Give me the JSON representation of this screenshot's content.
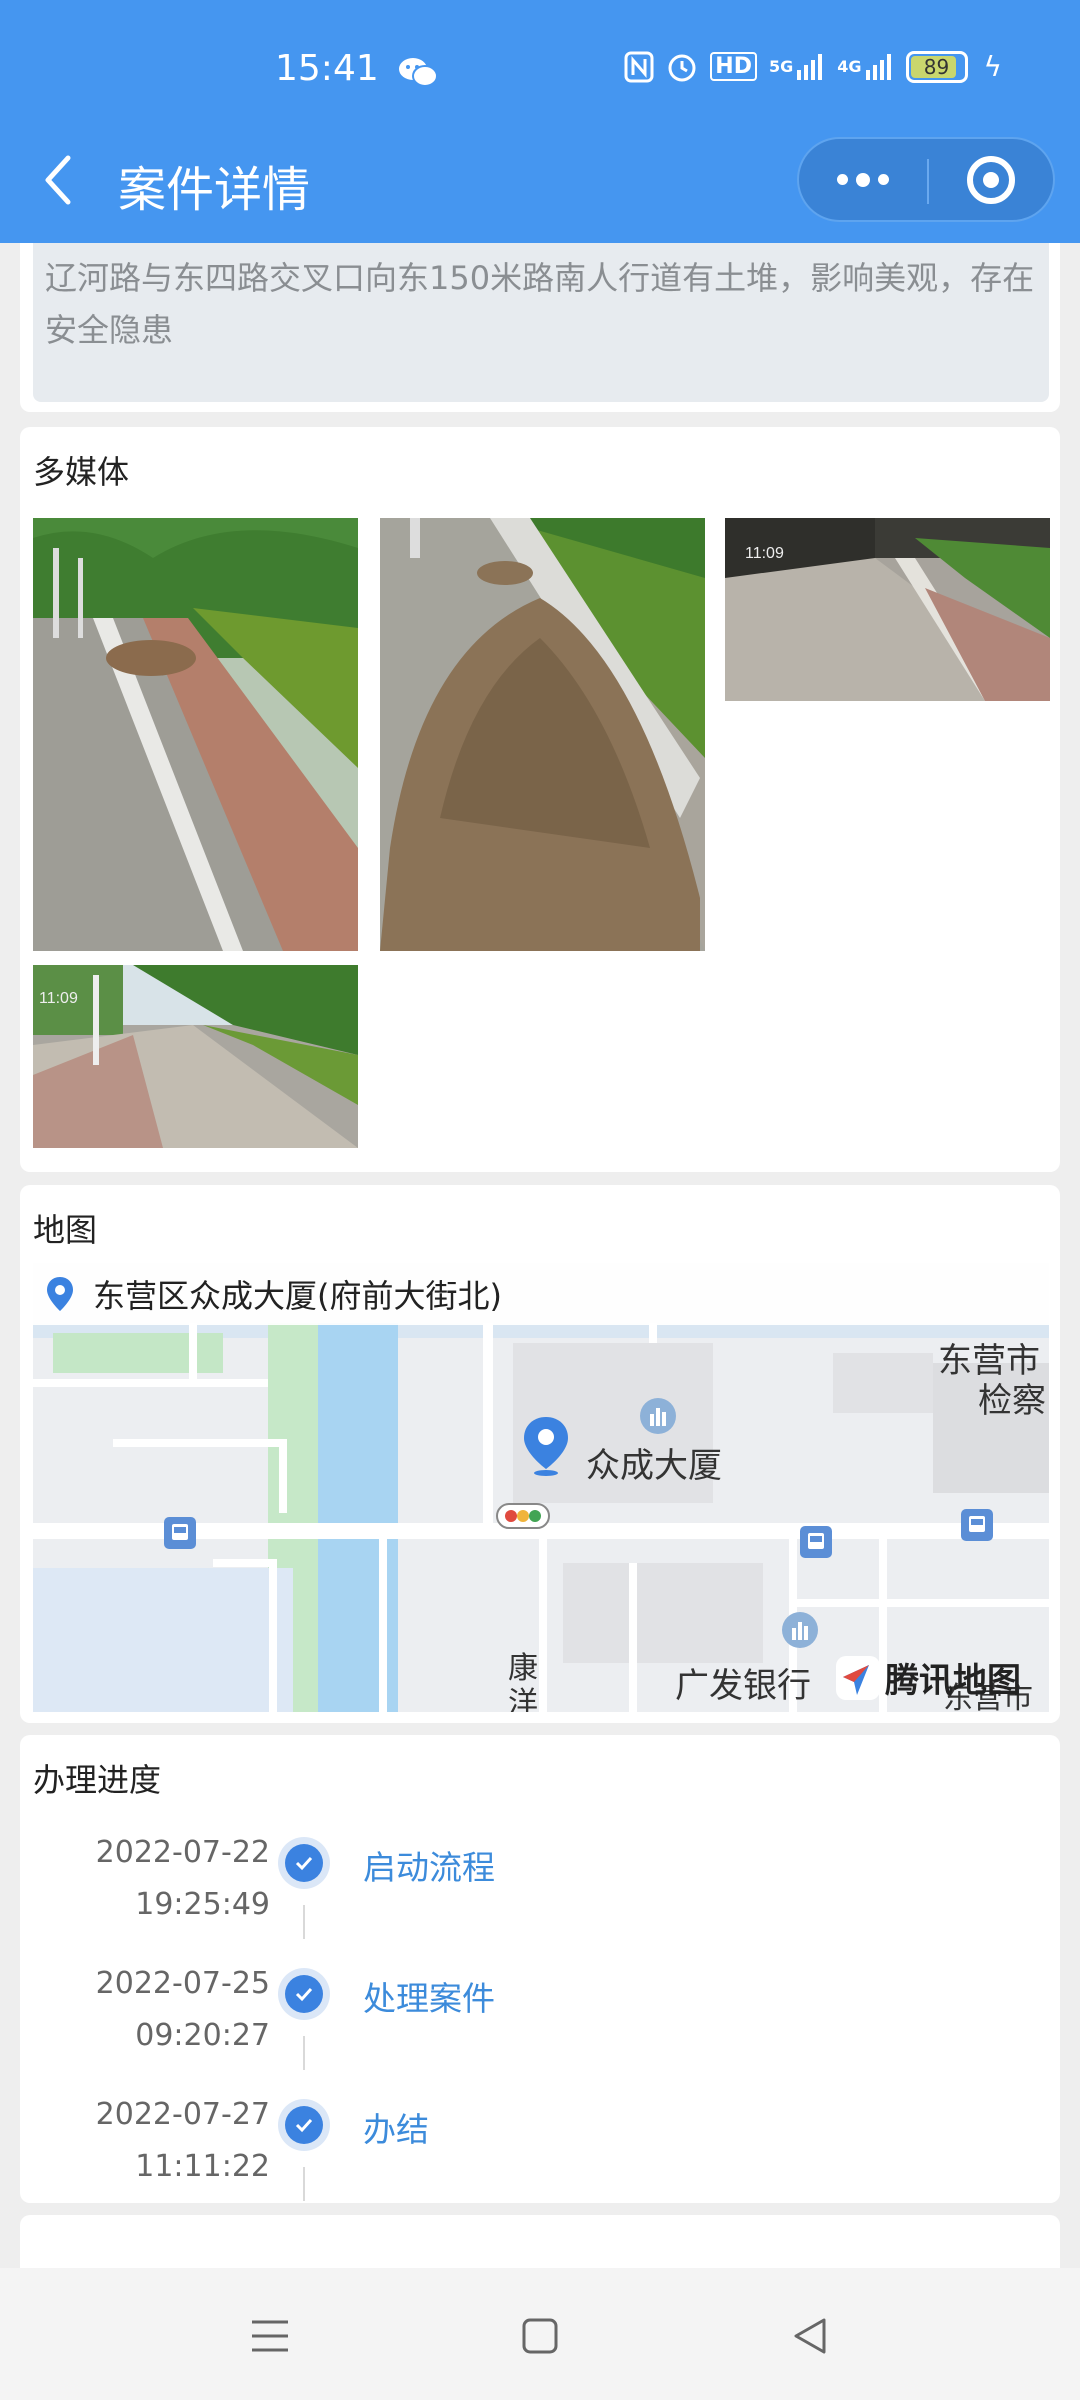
{
  "status_bar": {
    "time": "15:41",
    "icons": [
      "wechat-icon",
      "nfc-icon",
      "alarm-icon",
      "hd-icon",
      "5g-signal-icon",
      "4g-signal-icon",
      "battery-icon",
      "charging-icon"
    ],
    "network_5g": "5G",
    "network_4g": "4G",
    "hd_label": "HD",
    "battery": "89",
    "battery_level": 0.89
  },
  "header": {
    "title": "案件详情",
    "back_icon": "chevron-left-icon",
    "more_icon": "more-dots-icon",
    "close_icon": "target-close-icon"
  },
  "description": {
    "text": "辽河路与东四路交叉口向东150米路南人行道有土堆，影响美观，存在安全隐患"
  },
  "media": {
    "title": "多媒体",
    "photos": [
      {
        "name": "photo-1"
      },
      {
        "name": "photo-2"
      },
      {
        "name": "photo-3",
        "timestamp": "11:09"
      },
      {
        "name": "photo-4",
        "timestamp": "11:09"
      }
    ]
  },
  "map": {
    "title": "地图",
    "address": "东营区众成大厦(府前大街北)",
    "labels": {
      "building": "众成大厦",
      "top_right_1": "东营市",
      "top_right_2": "检察",
      "bottom_left": "康",
      "bottom_left_2": "洋",
      "bank": "广发银行",
      "bottom_right": "东营市"
    },
    "provider": "腾讯地图"
  },
  "progress": {
    "title": "办理进度",
    "steps": [
      {
        "date": "2022-07-22",
        "time": "19:25:49",
        "label": "启动流程"
      },
      {
        "date": "2022-07-25",
        "time": "09:20:27",
        "label": "处理案件"
      },
      {
        "date": "2022-07-27",
        "time": "11:11:22",
        "label": "办结"
      }
    ]
  },
  "nav": {
    "menu_icon": "menu-icon",
    "home_icon": "home-square-icon",
    "back_icon": "back-triangle-icon"
  },
  "colors": {
    "primary": "#4596f0",
    "link": "#3c8bdb",
    "check": "#3b82e0"
  }
}
